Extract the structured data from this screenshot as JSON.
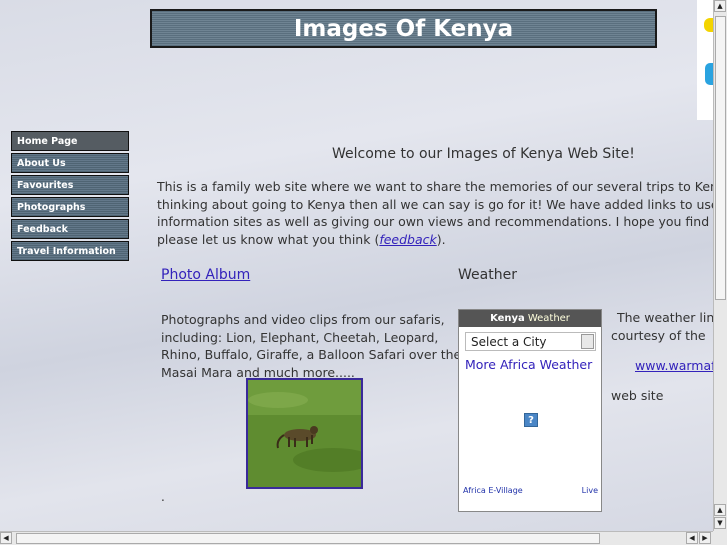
{
  "banner": {
    "title": "Images Of Kenya"
  },
  "nav": {
    "items": [
      {
        "label": "Home Page"
      },
      {
        "label": "About Us"
      },
      {
        "label": "Favourites"
      },
      {
        "label": "Photographs"
      },
      {
        "label": "Feedback"
      },
      {
        "label": "Travel Information"
      }
    ]
  },
  "main": {
    "welcome": "Welcome to our Images of Kenya Web Site!",
    "intro_lines": [
      "This is a family web site where we want to share the memories of our several trips to Kenya. If yo",
      "thinking about going to Kenya then all we can say is go for it! We have added links to useful advic",
      "information sites as well as giving our own views and  recommendations. I hope you find the site",
      "please let us know what you think ("
    ],
    "feedback_link": "feedback",
    "intro_end": ").",
    "photo_album_link": "Photo Album",
    "weather_heading": "Weather",
    "photo_text_lines": [
      "Photographs and video clips from our safaris,",
      "including: Lion, Elephant, Cheetah, Leopard,",
      "Rhino, Buffalo, Giraffe, a Balloon Safari over the",
      "Masai Mara and much more....."
    ],
    "dot": "."
  },
  "weather_widget": {
    "header_bold": "Kenya",
    "header_rest": "Weather",
    "select_value": "Select a City",
    "more_link": "More Africa Weather",
    "help_glyph": "?",
    "footer_left": "Africa  E-Village",
    "footer_right": "Live"
  },
  "weather_credit": {
    "line1": "The weather link",
    "line2": "courtesy of the",
    "link": "www.warmafr",
    "line3": "web  site"
  },
  "colors": {
    "banner_bg": "#5a6f7e",
    "link": "#3322bb",
    "nav_bg": "#4f6473"
  }
}
